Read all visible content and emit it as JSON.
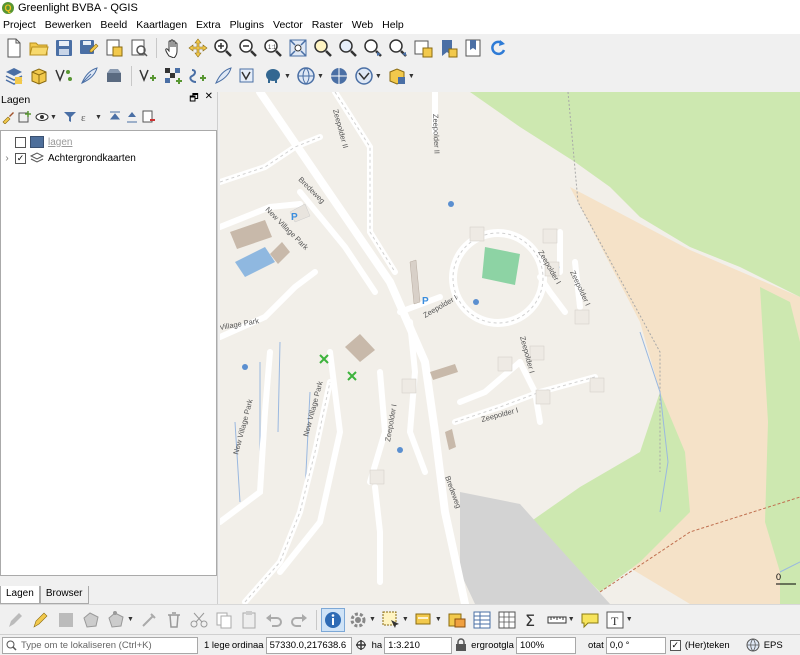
{
  "window": {
    "title": "Greenlight BVBA - QGIS"
  },
  "menu": [
    "Project",
    "Bewerken",
    "Beeld",
    "Kaartlagen",
    "Extra",
    "Plugins",
    "Vector",
    "Raster",
    "Web",
    "Help"
  ],
  "layers_panel": {
    "title": "Lagen",
    "layers": [
      {
        "name": "lagen",
        "checked": false,
        "expanded": false
      },
      {
        "name": "Achtergrondkaarten",
        "checked": true,
        "expanded": false
      }
    ],
    "tabs": [
      {
        "label": "Lagen",
        "active": true
      },
      {
        "label": "Browser",
        "active": false
      }
    ]
  },
  "map": {
    "street_labels": [
      {
        "text": "Zeepolder II"
      },
      {
        "text": "Zeepolder II"
      },
      {
        "text": "Bredeweg"
      },
      {
        "text": "New Village Park"
      },
      {
        "text": "Village Park"
      },
      {
        "text": "New Village Park"
      },
      {
        "text": "New Village Park"
      },
      {
        "text": "Zeepolder I"
      },
      {
        "text": "Zeepolder I"
      },
      {
        "text": "Zeepolder I"
      },
      {
        "text": "Zeepolder I"
      },
      {
        "text": "Zeepolder I"
      },
      {
        "text": "Zeepolder I"
      },
      {
        "text": "Bredeweg"
      }
    ],
    "parking_symbol": "P",
    "scale_corner_label": "0",
    "colors": {
      "background": "#f2efe9",
      "meadow": "#cde8b0",
      "farmland": "#f5e2c8",
      "building": "#c8b9aa",
      "pitch": "#8dd3a4",
      "water": "#8fb8e0",
      "marker": "#3db33d"
    }
  },
  "statusbar": {
    "locator_placeholder": "Type om te lokaliseren (Ctrl+K)",
    "legend_msg": "1 lege",
    "coord_label": "ordinaa",
    "coordinate": "57330.0,217638.6",
    "scale_label": "ha",
    "scale": "1:3.210",
    "magnifier_label": "ergrootgla",
    "magnifier": "100%",
    "rotation_label": "otat",
    "rotation": "0,0 °",
    "render_label": "(Her)teken",
    "render_checked": true,
    "crs": "EPS"
  }
}
